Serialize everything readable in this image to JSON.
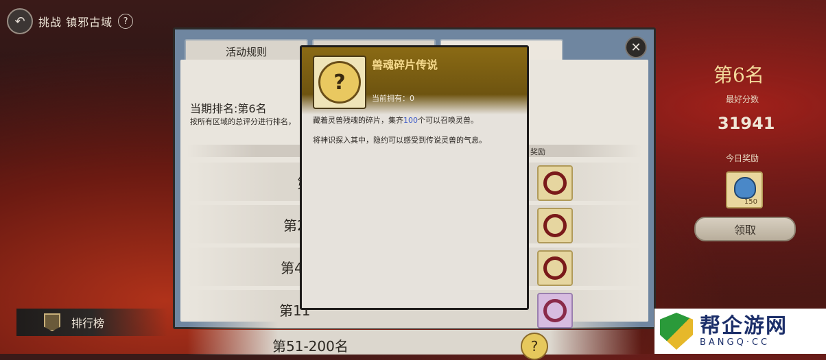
{
  "header": {
    "title": "挑战 镇邪古域",
    "help": "?"
  },
  "tabs": [
    {
      "label": "活动规则"
    },
    {
      "label": ""
    },
    {
      "label": ""
    }
  ],
  "panel": {
    "rank_heading": "当期排名:第6名",
    "rank_desc": "按所有区域的总评分进行排名，",
    "reward_col": "奖励",
    "rows": [
      {
        "label": "第"
      },
      {
        "label": "第2"
      },
      {
        "label": "第4"
      },
      {
        "label": "第11"
      },
      {
        "label": "第51-200名"
      }
    ]
  },
  "tooltip": {
    "item_name": "兽魂碎片传说",
    "owned": "当前拥有：0",
    "desc_prefix": "藏着灵兽残魂的碎片，集齐",
    "desc_highlight": "100",
    "desc_suffix": "个可以召唤灵兽。",
    "desc_line2": "将神识探入其中，隐约可以感受到传说灵兽的气息。",
    "icon": "question-coin-icon"
  },
  "side": {
    "rank": "第6名",
    "best_label": "最好分数",
    "best_value": "31941",
    "today_label": "今日奖励",
    "today_count": "150",
    "claim": "领取"
  },
  "leaderboard": {
    "label": "排行榜"
  },
  "watermark": {
    "main": "帮企游网",
    "sub": "BANGQ·CC"
  },
  "colors": {
    "accent_gold": "#f5d98c",
    "highlight_blue": "#3a58c8",
    "panel_blue": "#6f86a0"
  }
}
